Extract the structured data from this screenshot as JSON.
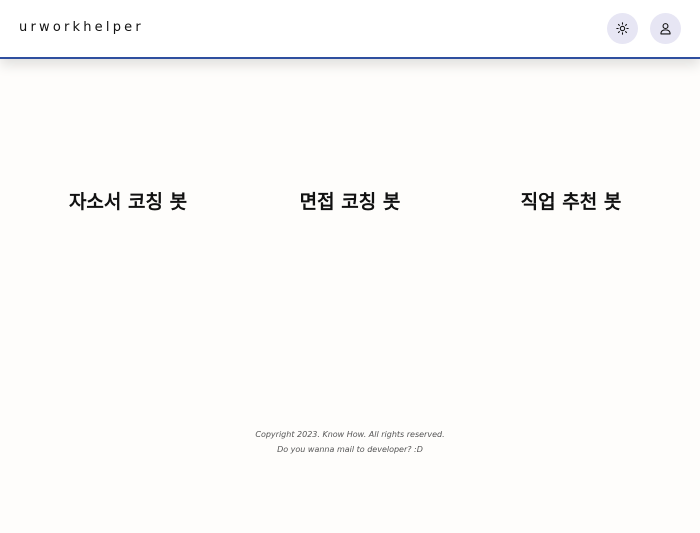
{
  "header": {
    "brand": "urworkhelper",
    "theme_toggle_icon": "sun-icon",
    "profile_icon": "user-icon",
    "accent_color": "#2f4f9f"
  },
  "main": {
    "bots": [
      {
        "label": "자소서 코칭 봇"
      },
      {
        "label": "면접 코칭 봇"
      },
      {
        "label": "직업 추천 봇"
      }
    ]
  },
  "footer": {
    "copyright": "Copyright 2023. Know How. All rights reserved.",
    "mail_link": "Do you wanna mail to developer? :D"
  }
}
